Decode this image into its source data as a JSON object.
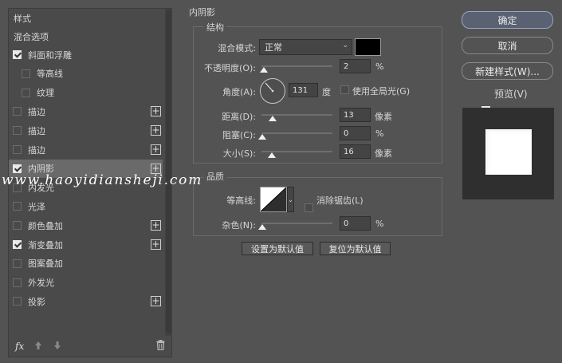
{
  "styles_panel": {
    "header": "样式",
    "blend_options": "混合选项",
    "items": [
      {
        "label": "斜面和浮雕",
        "checked": true,
        "plus": false,
        "indent": false
      },
      {
        "label": "等高线",
        "checked": false,
        "plus": false,
        "indent": true
      },
      {
        "label": "纹理",
        "checked": false,
        "plus": false,
        "indent": true
      },
      {
        "label": "描边",
        "checked": false,
        "plus": true,
        "indent": false
      },
      {
        "label": "描边",
        "checked": false,
        "plus": true,
        "indent": false
      },
      {
        "label": "描边",
        "checked": false,
        "plus": true,
        "indent": false
      },
      {
        "label": "内阴影",
        "checked": true,
        "plus": true,
        "indent": false,
        "selected": true
      },
      {
        "label": "内发光",
        "checked": false,
        "plus": false,
        "indent": false
      },
      {
        "label": "光泽",
        "checked": false,
        "plus": false,
        "indent": false
      },
      {
        "label": "颜色叠加",
        "checked": false,
        "plus": true,
        "indent": false
      },
      {
        "label": "渐变叠加",
        "checked": true,
        "plus": true,
        "indent": false
      },
      {
        "label": "图案叠加",
        "checked": false,
        "plus": false,
        "indent": false
      },
      {
        "label": "外发光",
        "checked": false,
        "plus": false,
        "indent": false
      },
      {
        "label": "投影",
        "checked": false,
        "plus": true,
        "indent": false
      }
    ],
    "footer": {
      "fx": "fx",
      "up_icon": "arrow-up-icon",
      "down_icon": "arrow-down-icon",
      "trash_icon": "trash-icon"
    }
  },
  "inner_shadow": {
    "title": "内阴影",
    "structure": {
      "title": "结构",
      "blend_mode_label": "混合模式:",
      "blend_mode_value": "正常",
      "shadow_color": "#000000",
      "opacity_label": "不透明度(O):",
      "opacity_value": "2",
      "opacity_unit": "%",
      "angle_label": "角度(A):",
      "angle_value": "131",
      "angle_unit": "度",
      "global_light_label": "使用全局光(G)",
      "global_light_checked": false,
      "distance_label": "距离(D):",
      "distance_value": "13",
      "distance_unit": "像素",
      "choke_label": "阻塞(C):",
      "choke_value": "0",
      "choke_unit": "%",
      "size_label": "大小(S):",
      "size_value": "16",
      "size_unit": "像素"
    },
    "quality": {
      "title": "品质",
      "contour_label": "等高线:",
      "anti_alias_label": "消除锯齿(L)",
      "anti_alias_checked": false,
      "noise_label": "杂色(N):",
      "noise_value": "0",
      "noise_unit": "%"
    },
    "make_default": "设置为默认值",
    "reset_default": "复位为默认值"
  },
  "actions": {
    "ok": "确定",
    "cancel": "取消",
    "new_style": "新建样式(W)...",
    "preview_label": "预览(V)",
    "preview_checked": true
  },
  "watermark": "www.haoyidiansheji.com"
}
